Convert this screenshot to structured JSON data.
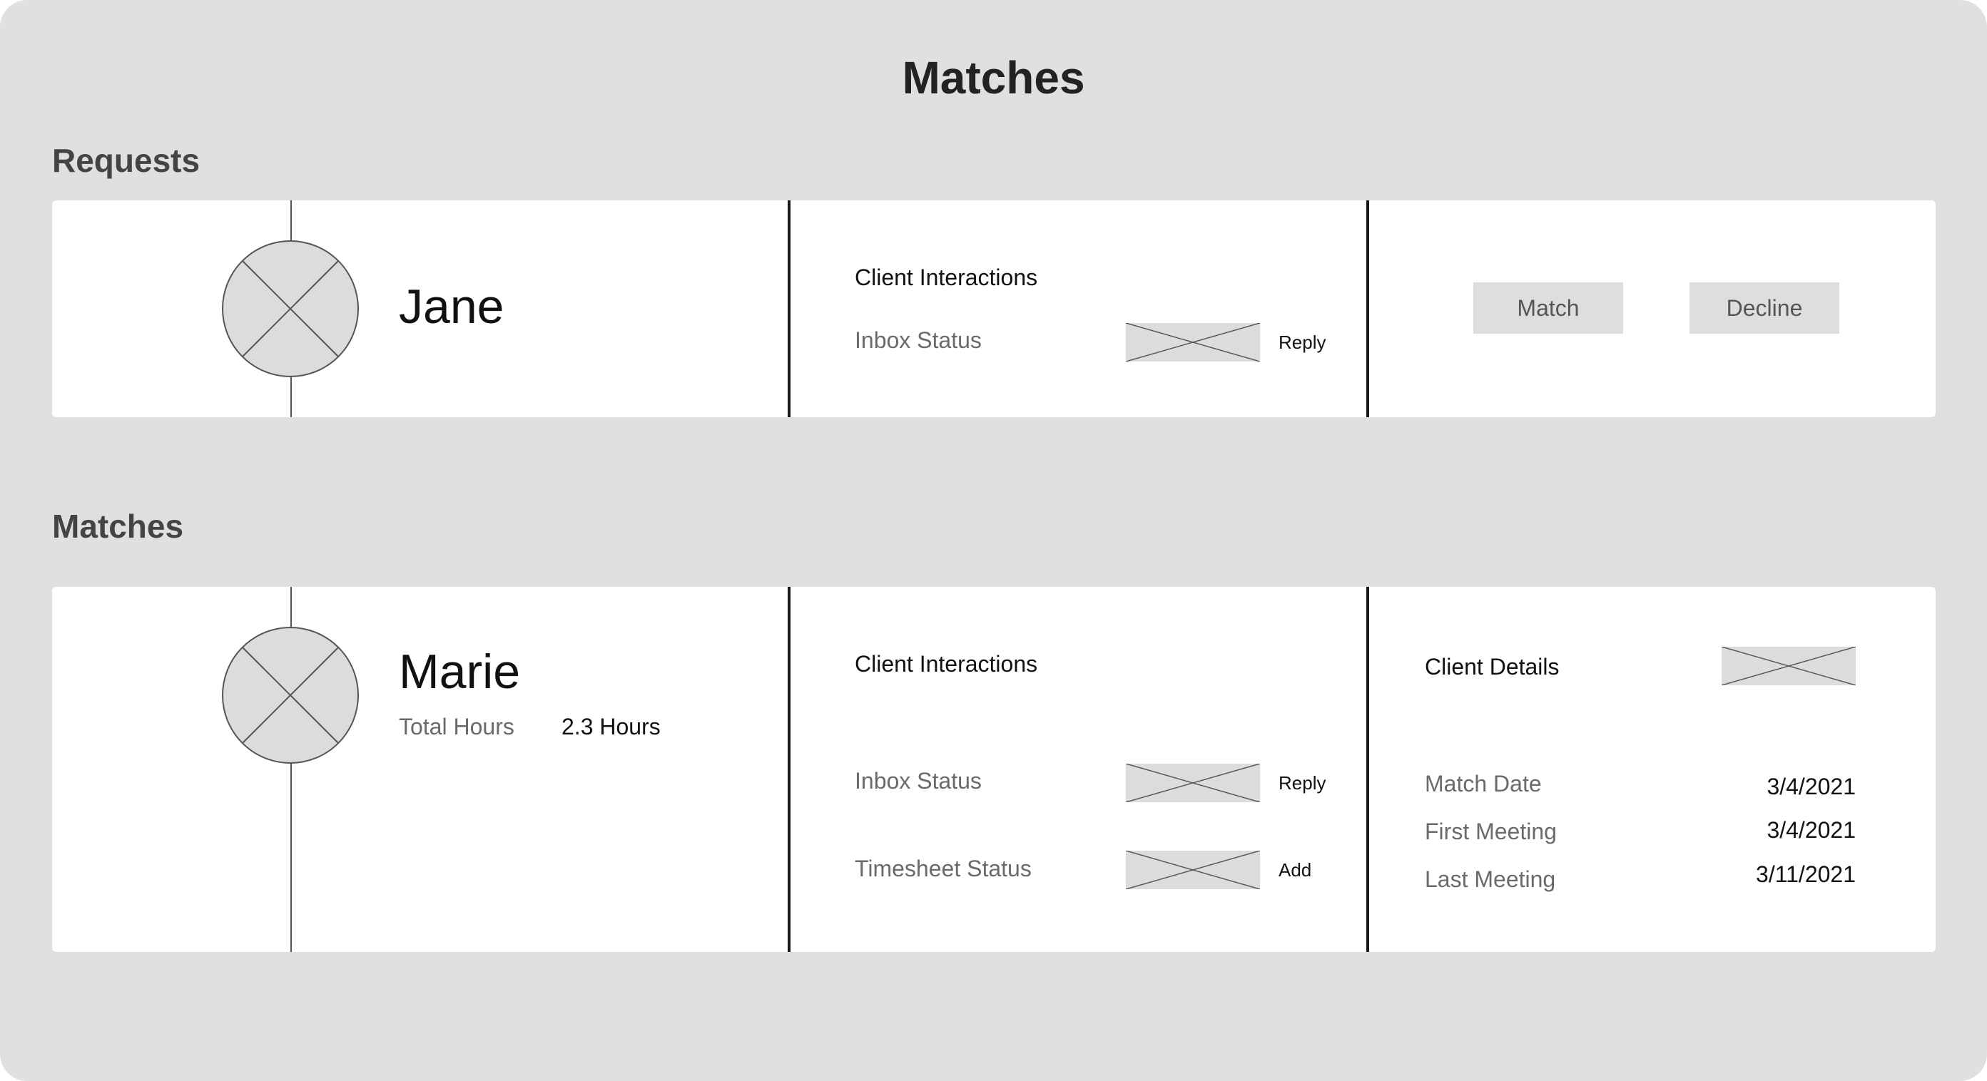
{
  "page": {
    "title": "Matches"
  },
  "requests": {
    "heading": "Requests",
    "card": {
      "name": "Jane",
      "interactions": {
        "heading": "Client Interactions",
        "inbox_label": "Inbox Status",
        "reply_label": "Reply"
      },
      "actions": {
        "match_label": "Match",
        "decline_label": "Decline"
      }
    }
  },
  "matches": {
    "heading": "Matches",
    "card": {
      "name": "Marie",
      "hours_label": "Total Hours",
      "hours_value": "2.3 Hours",
      "interactions": {
        "heading": "Client Interactions",
        "inbox_label": "Inbox Status",
        "reply_label": "Reply",
        "timesheet_label": "Timesheet Status",
        "add_label": "Add"
      },
      "details": {
        "heading": "Client Details",
        "rows": [
          {
            "label": "Match Date",
            "value": "3/4/2021"
          },
          {
            "label": "First Meeting",
            "value": "3/4/2021"
          },
          {
            "label": "Last Meeting",
            "value": "3/11/2021"
          }
        ]
      }
    }
  },
  "colors": {
    "background": "#e0e0e0",
    "card": "#ffffff",
    "placeholder": "#dcdcdc"
  },
  "icons": {
    "avatar": "avatar-placeholder-icon",
    "status": "image-placeholder-icon"
  }
}
